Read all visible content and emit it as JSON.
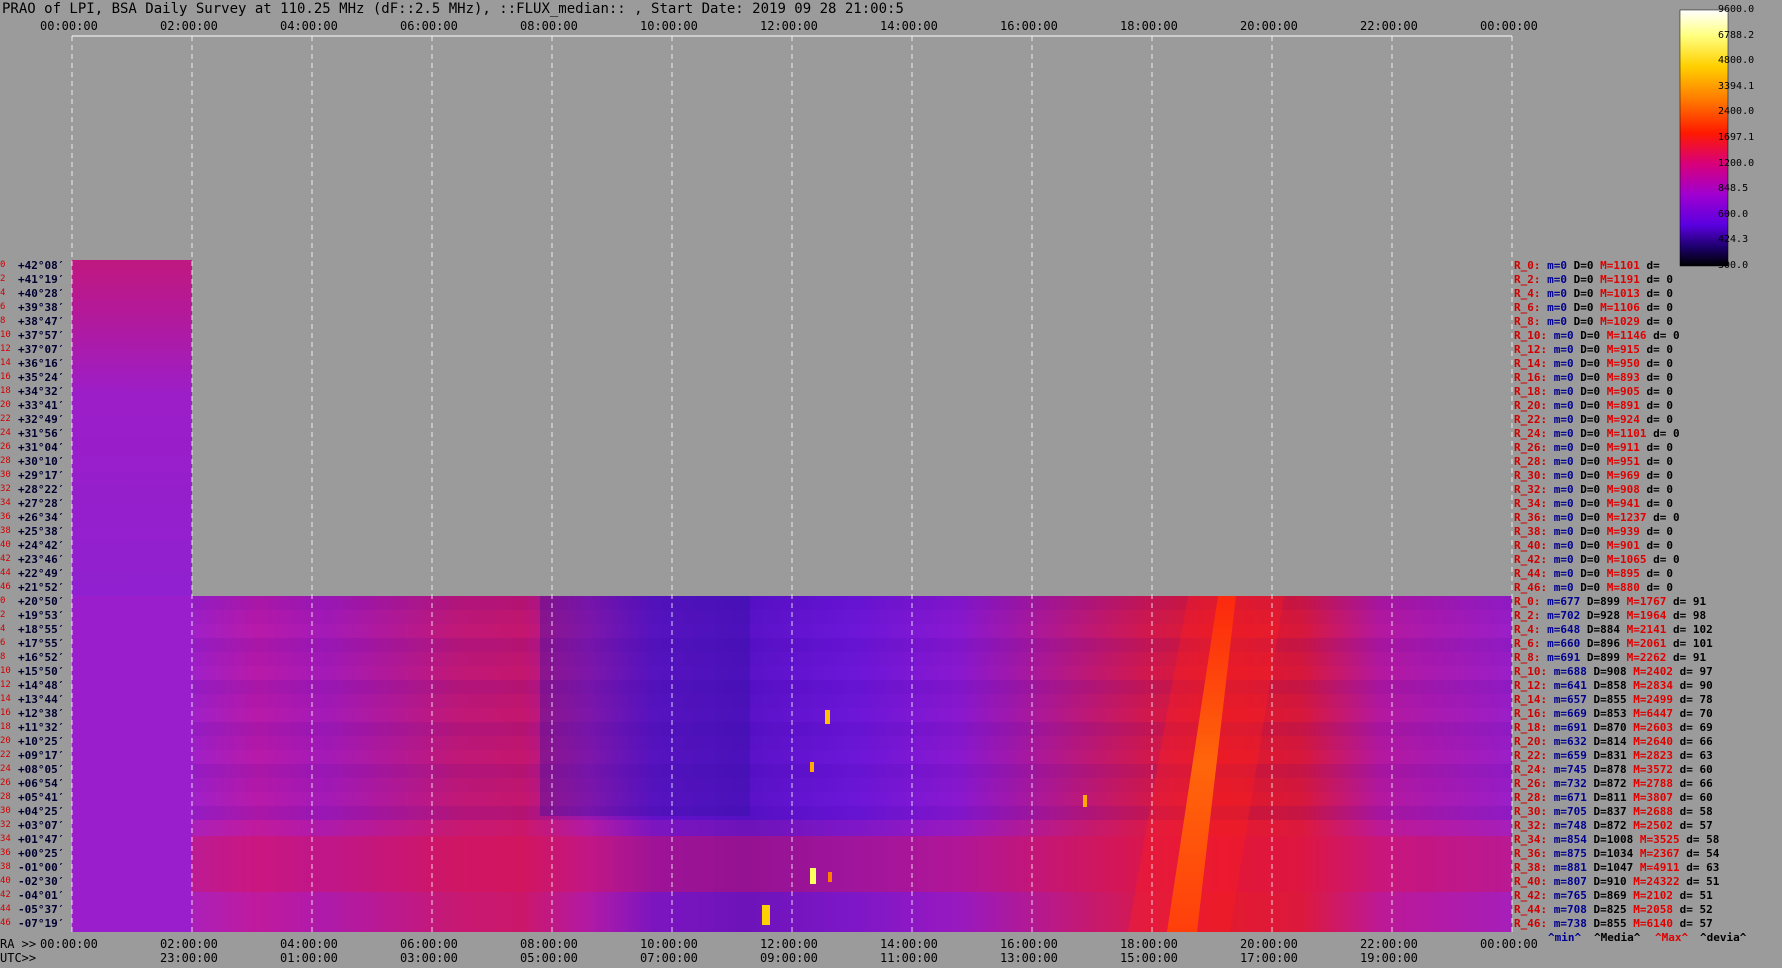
{
  "title": "PRAO of LPI, BSA Daily Survey at 110.25 MHz (dF::2.5 MHz), ::FLUX_median:: , Start Date: 2019 09 28 21:00:5",
  "top_axis_labels": [
    "00:00:00",
    "02:00:00",
    "04:00:00",
    "06:00:00",
    "08:00:00",
    "10:00:00",
    "12:00:00",
    "14:00:00",
    "16:00:00",
    "18:00:00",
    "20:00:00",
    "22:00:00",
    "00:00:00"
  ],
  "bottom_ra_prefix": "RA >>",
  "bottom_ra_labels": [
    "00:00:00",
    "02:00:00",
    "04:00:00",
    "06:00:00",
    "08:00:00",
    "10:00:00",
    "12:00:00",
    "14:00:00",
    "16:00:00",
    "18:00:00",
    "20:00:00",
    "22:00:00",
    "00:00:00"
  ],
  "bottom_utc_prefix": "UTC>>",
  "bottom_utc_labels": [
    "23:00:00",
    "01:00:00",
    "03:00:00",
    "05:00:00",
    "07:00:00",
    "09:00:00",
    "11:00:00",
    "13:00:00",
    "15:00:00",
    "17:00:00",
    "19:00:00"
  ],
  "colorbar_ticks": [
    "9600.0",
    "6788.2",
    "4800.0",
    "3394.1",
    "2400.0",
    "1697.1",
    "1200.0",
    "848.5",
    "600.0",
    "424.3",
    "300.0"
  ],
  "legend": {
    "min": "^min^",
    "median": "^Media^",
    "max": "^Max^",
    "devia": "^devia^"
  },
  "declinations_upper": [
    "+42°08′",
    "+41°19′",
    "+40°28′",
    "+39°38′",
    "+38°47′",
    "+37°57′",
    "+37°07′",
    "+36°16′",
    "+35°24′",
    "+34°32′",
    "+33°41′",
    "+32°49′",
    "+31°56′",
    "+31°04′",
    "+30°10′",
    "+29°17′",
    "+28°22′",
    "+27°28′",
    "+26°34′",
    "+25°38′",
    "+24°42′",
    "+23°46′",
    "+22°49′",
    "+21°52′"
  ],
  "declinations_lower": [
    "+20°50′",
    "+19°53′",
    "+18°55′",
    "+17°55′",
    "+16°52′",
    "+15°50′",
    "+14°48′",
    "+13°44′",
    "+12°38′",
    "+11°32′",
    "+10°25′",
    "+09°17′",
    "+08°05′",
    "+06°54′",
    "+05°41′",
    "+04°25′",
    "+03°07′",
    "+01°47′",
    "+00°25′",
    "-01°00′",
    "-02°30′",
    "-04°01′",
    "-05°37′",
    "-07°19′"
  ],
  "stats_upper": [
    {
      "r": "R_0:",
      "m": "m=0",
      "D": "D=0",
      "M": "M=1101",
      "d": "d="
    },
    {
      "r": "R_2:",
      "m": "m=0",
      "D": "D=0",
      "M": "M=1191",
      "d": "d= 0"
    },
    {
      "r": "R_4:",
      "m": "m=0",
      "D": "D=0",
      "M": "M=1013",
      "d": "d= 0"
    },
    {
      "r": "R_6:",
      "m": "m=0",
      "D": "D=0",
      "M": "M=1106",
      "d": "d= 0"
    },
    {
      "r": "R_8:",
      "m": "m=0",
      "D": "D=0",
      "M": "M=1029",
      "d": "d= 0"
    },
    {
      "r": "R_10:",
      "m": "m=0",
      "D": "D=0",
      "M": "M=1146",
      "d": "d= 0"
    },
    {
      "r": "R_12:",
      "m": "m=0",
      "D": "D=0",
      "M": "M=915",
      "d": "d= 0"
    },
    {
      "r": "R_14:",
      "m": "m=0",
      "D": "D=0",
      "M": "M=950",
      "d": "d= 0"
    },
    {
      "r": "R_16:",
      "m": "m=0",
      "D": "D=0",
      "M": "M=893",
      "d": "d= 0"
    },
    {
      "r": "R_18:",
      "m": "m=0",
      "D": "D=0",
      "M": "M=905",
      "d": "d= 0"
    },
    {
      "r": "R_20:",
      "m": "m=0",
      "D": "D=0",
      "M": "M=891",
      "d": "d= 0"
    },
    {
      "r": "R_22:",
      "m": "m=0",
      "D": "D=0",
      "M": "M=924",
      "d": "d= 0"
    },
    {
      "r": "R_24:",
      "m": "m=0",
      "D": "D=0",
      "M": "M=1101",
      "d": "d= 0"
    },
    {
      "r": "R_26:",
      "m": "m=0",
      "D": "D=0",
      "M": "M=911",
      "d": "d= 0"
    },
    {
      "r": "R_28:",
      "m": "m=0",
      "D": "D=0",
      "M": "M=951",
      "d": "d= 0"
    },
    {
      "r": "R_30:",
      "m": "m=0",
      "D": "D=0",
      "M": "M=969",
      "d": "d= 0"
    },
    {
      "r": "R_32:",
      "m": "m=0",
      "D": "D=0",
      "M": "M=908",
      "d": "d= 0"
    },
    {
      "r": "R_34:",
      "m": "m=0",
      "D": "D=0",
      "M": "M=941",
      "d": "d= 0"
    },
    {
      "r": "R_36:",
      "m": "m=0",
      "D": "D=0",
      "M": "M=1237",
      "d": "d= 0"
    },
    {
      "r": "R_38:",
      "m": "m=0",
      "D": "D=0",
      "M": "M=939",
      "d": "d= 0"
    },
    {
      "r": "R_40:",
      "m": "m=0",
      "D": "D=0",
      "M": "M=901",
      "d": "d= 0"
    },
    {
      "r": "R_42:",
      "m": "m=0",
      "D": "D=0",
      "M": "M=1065",
      "d": "d= 0"
    },
    {
      "r": "R_44:",
      "m": "m=0",
      "D": "D=0",
      "M": "M=895",
      "d": "d= 0"
    },
    {
      "r": "R_46:",
      "m": "m=0",
      "D": "D=0",
      "M": "M=880",
      "d": "d= 0"
    }
  ],
  "stats_lower": [
    {
      "r": "R_0:",
      "m": "m=677",
      "D": "D=899",
      "M": "M=1767",
      "d": "d= 91"
    },
    {
      "r": "R_2:",
      "m": "m=702",
      "D": "D=928",
      "M": "M=1964",
      "d": "d= 98"
    },
    {
      "r": "R_4:",
      "m": "m=648",
      "D": "D=884",
      "M": "M=2141",
      "d": "d= 102"
    },
    {
      "r": "R_6:",
      "m": "m=660",
      "D": "D=896",
      "M": "M=2061",
      "d": "d= 101"
    },
    {
      "r": "R_8:",
      "m": "m=691",
      "D": "D=899",
      "M": "M=2262",
      "d": "d= 91"
    },
    {
      "r": "R_10:",
      "m": "m=688",
      "D": "D=908",
      "M": "M=2402",
      "d": "d= 97"
    },
    {
      "r": "R_12:",
      "m": "m=641",
      "D": "D=858",
      "M": "M=2834",
      "d": "d= 90"
    },
    {
      "r": "R_14:",
      "m": "m=657",
      "D": "D=855",
      "M": "M=2499",
      "d": "d= 78"
    },
    {
      "r": "R_16:",
      "m": "m=669",
      "D": "D=853",
      "M": "M=6447",
      "d": "d= 70"
    },
    {
      "r": "R_18:",
      "m": "m=691",
      "D": "D=870",
      "M": "M=2603",
      "d": "d= 69"
    },
    {
      "r": "R_20:",
      "m": "m=632",
      "D": "D=814",
      "M": "M=2640",
      "d": "d= 66"
    },
    {
      "r": "R_22:",
      "m": "m=659",
      "D": "D=831",
      "M": "M=2823",
      "d": "d= 63"
    },
    {
      "r": "R_24:",
      "m": "m=745",
      "D": "D=878",
      "M": "M=3572",
      "d": "d= 60"
    },
    {
      "r": "R_26:",
      "m": "m=732",
      "D": "D=872",
      "M": "M=2788",
      "d": "d= 66"
    },
    {
      "r": "R_28:",
      "m": "m=671",
      "D": "D=811",
      "M": "M=3807",
      "d": "d= 60"
    },
    {
      "r": "R_30:",
      "m": "m=705",
      "D": "D=837",
      "M": "M=2688",
      "d": "d= 58"
    },
    {
      "r": "R_32:",
      "m": "m=748",
      "D": "D=872",
      "M": "M=2502",
      "d": "d= 57"
    },
    {
      "r": "R_34:",
      "m": "m=854",
      "D": "D=1008",
      "M": "M=3525",
      "d": "d= 58"
    },
    {
      "r": "R_36:",
      "m": "m=875",
      "D": "D=1034",
      "M": "M=2367",
      "d": "d= 54"
    },
    {
      "r": "R_38:",
      "m": "m=881",
      "D": "D=1047",
      "M": "M=4911",
      "d": "d= 63"
    },
    {
      "r": "R_40:",
      "m": "m=807",
      "D": "D=910",
      "M": "M=24322",
      "d": "d= 51"
    },
    {
      "r": "R_42:",
      "m": "m=765",
      "D": "D=869",
      "M": "M=2102",
      "d": "d= 51"
    },
    {
      "r": "R_44:",
      "m": "m=708",
      "D": "D=825",
      "M": "M=2058",
      "d": "d= 52"
    },
    {
      "r": "R_46:",
      "m": "m=738",
      "D": "D=855",
      "M": "M=6140",
      "d": "d= 57"
    }
  ],
  "chart_data": {
    "type": "heatmap",
    "x_range_hours": [
      0,
      24
    ],
    "colorscale_range": [
      300.0,
      9600.0
    ],
    "grid": true,
    "colormap_stops": [
      "#000000",
      "#1a006e",
      "#6a00e0",
      "#a000c8",
      "#d8006a",
      "#ff1a00",
      "#ff8000",
      "#ffd000",
      "#ffff60",
      "#ffffff"
    ]
  }
}
